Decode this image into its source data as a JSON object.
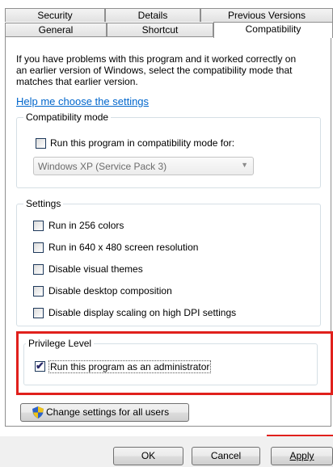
{
  "tabs": {
    "row1": [
      "Security",
      "Details",
      "Previous Versions"
    ],
    "row2": [
      "General",
      "Shortcut",
      "Compatibility"
    ],
    "active": "Compatibility"
  },
  "intro": {
    "line1": "If you have problems with this program and it worked correctly on",
    "line2": "an earlier version of Windows, select the compatibility mode that",
    "line3": "matches that earlier version.",
    "help_link": "Help me choose the settings"
  },
  "compat_mode": {
    "title": "Compatibility mode",
    "checkbox_label": "Run this program in compatibility mode for:",
    "checked": false,
    "selected_os": "Windows XP (Service Pack 3)"
  },
  "settings": {
    "title": "Settings",
    "items": [
      {
        "label": "Run in 256 colors",
        "checked": false
      },
      {
        "label": "Run in 640 x 480 screen resolution",
        "checked": false
      },
      {
        "label": "Disable visual themes",
        "checked": false
      },
      {
        "label": "Disable desktop composition",
        "checked": false
      },
      {
        "label": "Disable display scaling on high DPI settings",
        "checked": false
      }
    ]
  },
  "privilege": {
    "title": "Privilege Level",
    "checkbox_label": "Run this program as an administrator",
    "checked": true
  },
  "change_all_users_label": "Change settings for all users",
  "footer": {
    "ok": "OK",
    "cancel": "Cancel",
    "apply": "Apply"
  },
  "highlight_color": "#e0201c",
  "link_color": "#0066cc"
}
